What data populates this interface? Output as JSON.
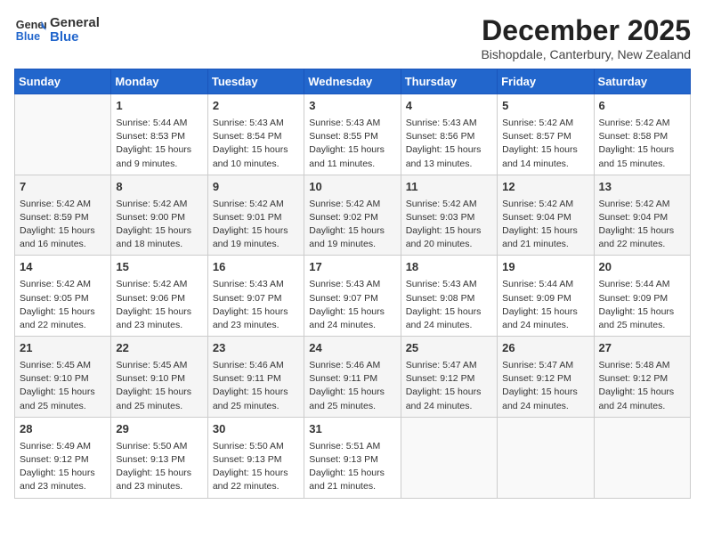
{
  "header": {
    "logo_general": "General",
    "logo_blue": "Blue",
    "month": "December 2025",
    "location": "Bishopdale, Canterbury, New Zealand"
  },
  "weekdays": [
    "Sunday",
    "Monday",
    "Tuesday",
    "Wednesday",
    "Thursday",
    "Friday",
    "Saturday"
  ],
  "weeks": [
    [
      {
        "day": "",
        "lines": []
      },
      {
        "day": "1",
        "lines": [
          "Sunrise: 5:44 AM",
          "Sunset: 8:53 PM",
          "Daylight: 15 hours",
          "and 9 minutes."
        ]
      },
      {
        "day": "2",
        "lines": [
          "Sunrise: 5:43 AM",
          "Sunset: 8:54 PM",
          "Daylight: 15 hours",
          "and 10 minutes."
        ]
      },
      {
        "day": "3",
        "lines": [
          "Sunrise: 5:43 AM",
          "Sunset: 8:55 PM",
          "Daylight: 15 hours",
          "and 11 minutes."
        ]
      },
      {
        "day": "4",
        "lines": [
          "Sunrise: 5:43 AM",
          "Sunset: 8:56 PM",
          "Daylight: 15 hours",
          "and 13 minutes."
        ]
      },
      {
        "day": "5",
        "lines": [
          "Sunrise: 5:42 AM",
          "Sunset: 8:57 PM",
          "Daylight: 15 hours",
          "and 14 minutes."
        ]
      },
      {
        "day": "6",
        "lines": [
          "Sunrise: 5:42 AM",
          "Sunset: 8:58 PM",
          "Daylight: 15 hours",
          "and 15 minutes."
        ]
      }
    ],
    [
      {
        "day": "7",
        "lines": [
          "Sunrise: 5:42 AM",
          "Sunset: 8:59 PM",
          "Daylight: 15 hours",
          "and 16 minutes."
        ]
      },
      {
        "day": "8",
        "lines": [
          "Sunrise: 5:42 AM",
          "Sunset: 9:00 PM",
          "Daylight: 15 hours",
          "and 18 minutes."
        ]
      },
      {
        "day": "9",
        "lines": [
          "Sunrise: 5:42 AM",
          "Sunset: 9:01 PM",
          "Daylight: 15 hours",
          "and 19 minutes."
        ]
      },
      {
        "day": "10",
        "lines": [
          "Sunrise: 5:42 AM",
          "Sunset: 9:02 PM",
          "Daylight: 15 hours",
          "and 19 minutes."
        ]
      },
      {
        "day": "11",
        "lines": [
          "Sunrise: 5:42 AM",
          "Sunset: 9:03 PM",
          "Daylight: 15 hours",
          "and 20 minutes."
        ]
      },
      {
        "day": "12",
        "lines": [
          "Sunrise: 5:42 AM",
          "Sunset: 9:04 PM",
          "Daylight: 15 hours",
          "and 21 minutes."
        ]
      },
      {
        "day": "13",
        "lines": [
          "Sunrise: 5:42 AM",
          "Sunset: 9:04 PM",
          "Daylight: 15 hours",
          "and 22 minutes."
        ]
      }
    ],
    [
      {
        "day": "14",
        "lines": [
          "Sunrise: 5:42 AM",
          "Sunset: 9:05 PM",
          "Daylight: 15 hours",
          "and 22 minutes."
        ]
      },
      {
        "day": "15",
        "lines": [
          "Sunrise: 5:42 AM",
          "Sunset: 9:06 PM",
          "Daylight: 15 hours",
          "and 23 minutes."
        ]
      },
      {
        "day": "16",
        "lines": [
          "Sunrise: 5:43 AM",
          "Sunset: 9:07 PM",
          "Daylight: 15 hours",
          "and 23 minutes."
        ]
      },
      {
        "day": "17",
        "lines": [
          "Sunrise: 5:43 AM",
          "Sunset: 9:07 PM",
          "Daylight: 15 hours",
          "and 24 minutes."
        ]
      },
      {
        "day": "18",
        "lines": [
          "Sunrise: 5:43 AM",
          "Sunset: 9:08 PM",
          "Daylight: 15 hours",
          "and 24 minutes."
        ]
      },
      {
        "day": "19",
        "lines": [
          "Sunrise: 5:44 AM",
          "Sunset: 9:09 PM",
          "Daylight: 15 hours",
          "and 24 minutes."
        ]
      },
      {
        "day": "20",
        "lines": [
          "Sunrise: 5:44 AM",
          "Sunset: 9:09 PM",
          "Daylight: 15 hours",
          "and 25 minutes."
        ]
      }
    ],
    [
      {
        "day": "21",
        "lines": [
          "Sunrise: 5:45 AM",
          "Sunset: 9:10 PM",
          "Daylight: 15 hours",
          "and 25 minutes."
        ]
      },
      {
        "day": "22",
        "lines": [
          "Sunrise: 5:45 AM",
          "Sunset: 9:10 PM",
          "Daylight: 15 hours",
          "and 25 minutes."
        ]
      },
      {
        "day": "23",
        "lines": [
          "Sunrise: 5:46 AM",
          "Sunset: 9:11 PM",
          "Daylight: 15 hours",
          "and 25 minutes."
        ]
      },
      {
        "day": "24",
        "lines": [
          "Sunrise: 5:46 AM",
          "Sunset: 9:11 PM",
          "Daylight: 15 hours",
          "and 25 minutes."
        ]
      },
      {
        "day": "25",
        "lines": [
          "Sunrise: 5:47 AM",
          "Sunset: 9:12 PM",
          "Daylight: 15 hours",
          "and 24 minutes."
        ]
      },
      {
        "day": "26",
        "lines": [
          "Sunrise: 5:47 AM",
          "Sunset: 9:12 PM",
          "Daylight: 15 hours",
          "and 24 minutes."
        ]
      },
      {
        "day": "27",
        "lines": [
          "Sunrise: 5:48 AM",
          "Sunset: 9:12 PM",
          "Daylight: 15 hours",
          "and 24 minutes."
        ]
      }
    ],
    [
      {
        "day": "28",
        "lines": [
          "Sunrise: 5:49 AM",
          "Sunset: 9:12 PM",
          "Daylight: 15 hours",
          "and 23 minutes."
        ]
      },
      {
        "day": "29",
        "lines": [
          "Sunrise: 5:50 AM",
          "Sunset: 9:13 PM",
          "Daylight: 15 hours",
          "and 23 minutes."
        ]
      },
      {
        "day": "30",
        "lines": [
          "Sunrise: 5:50 AM",
          "Sunset: 9:13 PM",
          "Daylight: 15 hours",
          "and 22 minutes."
        ]
      },
      {
        "day": "31",
        "lines": [
          "Sunrise: 5:51 AM",
          "Sunset: 9:13 PM",
          "Daylight: 15 hours",
          "and 21 minutes."
        ]
      },
      {
        "day": "",
        "lines": []
      },
      {
        "day": "",
        "lines": []
      },
      {
        "day": "",
        "lines": []
      }
    ]
  ]
}
